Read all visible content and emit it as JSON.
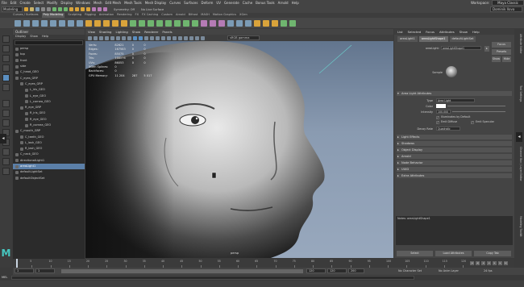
{
  "menubar": {
    "items": [
      "File",
      "Edit",
      "Create",
      "Select",
      "Modify",
      "Display",
      "Windows",
      "Mesh",
      "Edit Mesh",
      "Mesh Tools",
      "Mesh Display",
      "Curves",
      "Surfaces",
      "Deform",
      "UV",
      "Generate",
      "Cache",
      "Bonus Tools",
      "Arnold",
      "Help"
    ],
    "workspace_label": "Workspace:",
    "workspace_value": "Maya Classic"
  },
  "statusline": {
    "mode": "Modeling",
    "symmetry": "Symmetry: Off",
    "live_surface": "No Live Surface",
    "user": "Dominik Ilova"
  },
  "shelf_tabs": [
    "Curves / Surfaces",
    "Poly Modeling",
    "Sculpting",
    "Rigging",
    "Animation",
    "Rendering",
    "FX",
    "FX Caching",
    "Custom",
    "Arnold",
    "Bifrost",
    "MASH",
    "Motion Graphics",
    "XGen"
  ],
  "shelf_active": "Poly Modeling",
  "outliner": {
    "title": "Outliner",
    "menu": [
      "Display",
      "Show",
      "Help"
    ],
    "rows": [
      {
        "label": "persp",
        "indent": 0
      },
      {
        "label": "top",
        "indent": 0
      },
      {
        "label": "front",
        "indent": 0
      },
      {
        "label": "side",
        "indent": 0
      },
      {
        "label": "C_head_GEO",
        "indent": 0
      },
      {
        "label": "C_eyes_GRP",
        "indent": 0
      },
      {
        "label": "C_eyes_GRP",
        "indent": 1
      },
      {
        "label": "L_iris_GEO",
        "indent": 2
      },
      {
        "label": "L_eye_GEO",
        "indent": 2
      },
      {
        "label": "L_cornea_GEO",
        "indent": 2
      },
      {
        "label": "R_eye_GRP",
        "indent": 1
      },
      {
        "label": "R_iris_GEO",
        "indent": 2
      },
      {
        "label": "R_eye_GEO",
        "indent": 2
      },
      {
        "label": "R_cornea_GEO",
        "indent": 2
      },
      {
        "label": "C_mouth_GRP",
        "indent": 0
      },
      {
        "label": "C_teeth_GEO",
        "indent": 1
      },
      {
        "label": "L_lash_GEO",
        "indent": 1
      },
      {
        "label": "R_lash_GEO",
        "indent": 1
      },
      {
        "label": "C_neck_GEO",
        "indent": 0
      },
      {
        "label": "directionalLight1",
        "indent": 0
      },
      {
        "label": "areaLight1",
        "indent": 0,
        "selected": true
      },
      {
        "label": "defaultLightSet",
        "indent": 0
      },
      {
        "label": "defaultObjectSet",
        "indent": 0
      }
    ]
  },
  "viewport": {
    "menu": [
      "View",
      "Shading",
      "Lighting",
      "Show",
      "Renderer",
      "Panels"
    ],
    "camera_field": "sRGB gamma",
    "hud": [
      [
        "Verts:",
        "82621",
        "0",
        "0"
      ],
      [
        "Edges:",
        "167583",
        "0",
        "0"
      ],
      [
        "Faces:",
        "85075",
        "0",
        "0"
      ],
      [
        "Tris:",
        "166576",
        "0",
        "0"
      ],
      [
        "UVs:",
        "86053",
        "0",
        "0"
      ],
      [
        "",
        "",
        "",
        ""
      ],
      [
        "XGen Splines:",
        "0",
        "",
        ""
      ],
      [
        "Backfaces:",
        "0",
        "",
        ""
      ],
      [
        "GPU Memory:",
        "11 204",
        "287",
        "5 017"
      ]
    ],
    "camera_label": "persp"
  },
  "attribute_editor": {
    "tabs": [
      "List",
      "Selected",
      "Focus",
      "Attributes",
      "Show",
      "Help"
    ],
    "node_tabs": [
      "areaLight1",
      "areaLightShape1",
      "defaultLightSet"
    ],
    "node_label": "areaLight:",
    "node_value": "areaLightShape1",
    "focus_button": "Focus",
    "presets_button": "Presets",
    "show_button": "Show",
    "hide_button": "Hide",
    "sample_label": "Sample",
    "section_open": "Area Light Attributes",
    "type_label": "Type",
    "type_value": "Area Light",
    "color_label": "Color",
    "intensity_label": "Intensity",
    "intensity_value": "100.000",
    "illuminates_default": "Illuminates by Default",
    "emit_diffuse": "Emit Diffuse",
    "emit_specular": "Emit Specular",
    "decay_label": "Decay Rate",
    "decay_value": "Quadratic",
    "sections": [
      "Light Effects",
      "Shadows",
      "Object Display",
      "Arnold",
      "Node Behavior",
      "UUID",
      "Extra Attributes"
    ],
    "notes_label": "Notes: areaLightShape1",
    "buttons": [
      "Select",
      "Load Attributes",
      "Copy Tab"
    ]
  },
  "right_tabs": [
    "Attribute Editor",
    "Tool Settings",
    "Channel Box / Layer Editor",
    "Modeling Toolkit"
  ],
  "timeline": {
    "ticks": [
      "5",
      "10",
      "15",
      "20",
      "25",
      "30",
      "35",
      "40",
      "45",
      "50",
      "55",
      "60",
      "65",
      "70",
      "75",
      "80",
      "85",
      "90",
      "95",
      "100",
      "105",
      "110",
      "115",
      "120"
    ],
    "current_frame": "1"
  },
  "range": {
    "start": "1",
    "start_inner": "1",
    "end_inner": "120",
    "end": "120",
    "end_outer": "200",
    "character_set": "No Character Set",
    "anim_layer": "No Anim Layer",
    "fps": "24 fps"
  },
  "cmdline": {
    "lang": "MEL"
  },
  "colors": {
    "accent": "#5b8fc1",
    "maya_logo": "#46c7c0",
    "selection": "#5b7fa8"
  }
}
